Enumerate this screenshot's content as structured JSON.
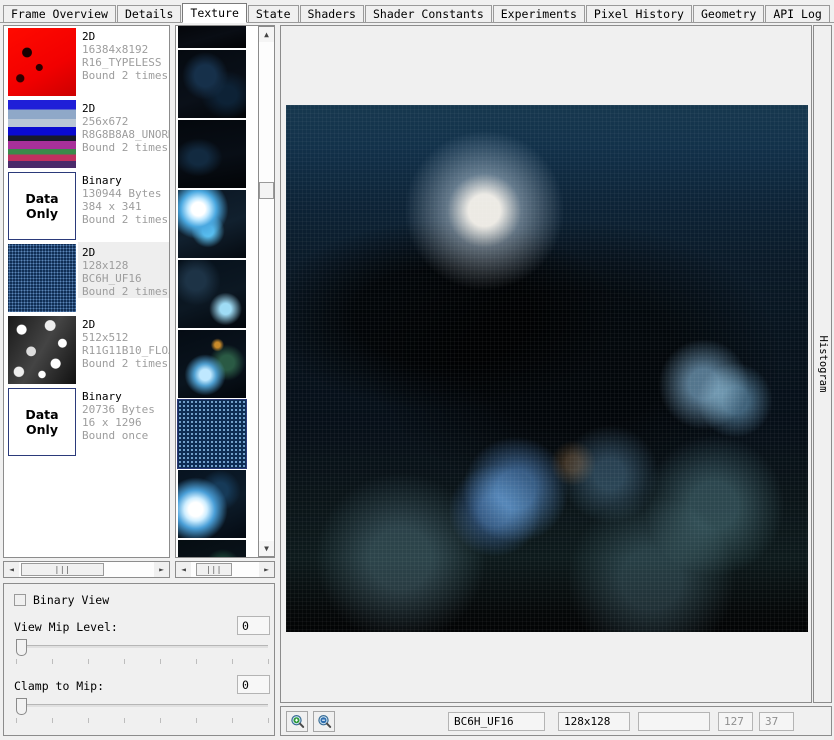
{
  "tabs": [
    {
      "label": "Frame Overview",
      "active": false
    },
    {
      "label": "Details",
      "active": false
    },
    {
      "label": "Texture",
      "active": true
    },
    {
      "label": "State",
      "active": false
    },
    {
      "label": "Shaders",
      "active": false
    },
    {
      "label": "Shader Constants",
      "active": false
    },
    {
      "label": "Experiments",
      "active": false
    },
    {
      "label": "Pixel History",
      "active": false
    },
    {
      "label": "Geometry",
      "active": false
    },
    {
      "label": "API Log",
      "active": false
    }
  ],
  "texture_list": [
    {
      "kind": "2D",
      "size": "16384x8192",
      "format": "R16_TYPELESS",
      "bound": "Bound 2 times",
      "thumb": "red-texture",
      "data_only": false,
      "selected": false
    },
    {
      "kind": "2D",
      "size": "256x672",
      "format": "R8G8B8A8_UNORM",
      "bound": "Bound 2 times",
      "thumb": "ui-atlas-texture",
      "data_only": false,
      "selected": false
    },
    {
      "kind": "Binary",
      "size": "130944 Bytes",
      "format": "384 x 341",
      "bound": "Bound 2 times",
      "thumb": "data-only",
      "data_only": true,
      "selected": false,
      "data_only_line1": "Data",
      "data_only_line2": "Only"
    },
    {
      "kind": "2D",
      "size": "128x128",
      "format": "BC6H_UF16",
      "bound": "Bound 2 times",
      "thumb": "blue-dot-texture",
      "data_only": false,
      "selected": true
    },
    {
      "kind": "2D",
      "size": "512x512",
      "format": "R11G11B10_FLOAT",
      "bound": "Bound 2 times",
      "thumb": "noise-texture",
      "data_only": false,
      "selected": false
    },
    {
      "kind": "Binary",
      "size": "20736 Bytes",
      "format": "16 x 1296",
      "bound": "Bound once",
      "thumb": "data-only",
      "data_only": true,
      "selected": false,
      "data_only_line1": "Data",
      "data_only_line2": "Only"
    }
  ],
  "thumbnail_strip": [
    {
      "name": "thumbnail-1",
      "style": "m-dark1",
      "partial": true,
      "selected": false
    },
    {
      "name": "thumbnail-2",
      "style": "m-dark2",
      "partial": false,
      "selected": false
    },
    {
      "name": "thumbnail-3",
      "style": "m-dark3",
      "partial": false,
      "selected": false
    },
    {
      "name": "thumbnail-4",
      "style": "m-cyanflare",
      "partial": false,
      "selected": false
    },
    {
      "name": "thumbnail-5",
      "style": "m-scene1",
      "partial": false,
      "selected": false
    },
    {
      "name": "thumbnail-6",
      "style": "m-scene2",
      "partial": false,
      "selected": false
    },
    {
      "name": "thumbnail-7",
      "style": "m-dots",
      "partial": false,
      "selected": true
    },
    {
      "name": "thumbnail-8",
      "style": "m-flare2",
      "partial": false,
      "selected": false
    },
    {
      "name": "thumbnail-9",
      "style": "m-scene3",
      "partial": false,
      "selected": false
    }
  ],
  "controls": {
    "binary_view_label": "Binary View",
    "binary_view_checked": false,
    "view_mip_label": "View Mip Level:",
    "view_mip_value": "0",
    "clamp_mip_label": "Clamp to Mip:",
    "clamp_mip_value": "0",
    "tick_count": 8
  },
  "viewer": {
    "histogram_label": "Histogram"
  },
  "statusbar": {
    "zoom_in_icon": "zoom-in-icon",
    "zoom_out_icon": "zoom-out-icon",
    "format": "BC6H_UF16",
    "dimensions": "128x128",
    "extra": "",
    "coord_x": "127",
    "coord_y": "37"
  },
  "scrollbars": {
    "left_arrow": "◄",
    "right_arrow": "►",
    "up_arrow": "▲",
    "down_arrow": "▼",
    "grip": "|||"
  },
  "colors": {
    "window_bg": "#f0f0f0",
    "panel_bg": "#ffffff",
    "border": "#8c8c8c",
    "muted_text": "#9d9d9d",
    "selection": "#eeeeee",
    "data_only_border": "#2b3a7a"
  }
}
